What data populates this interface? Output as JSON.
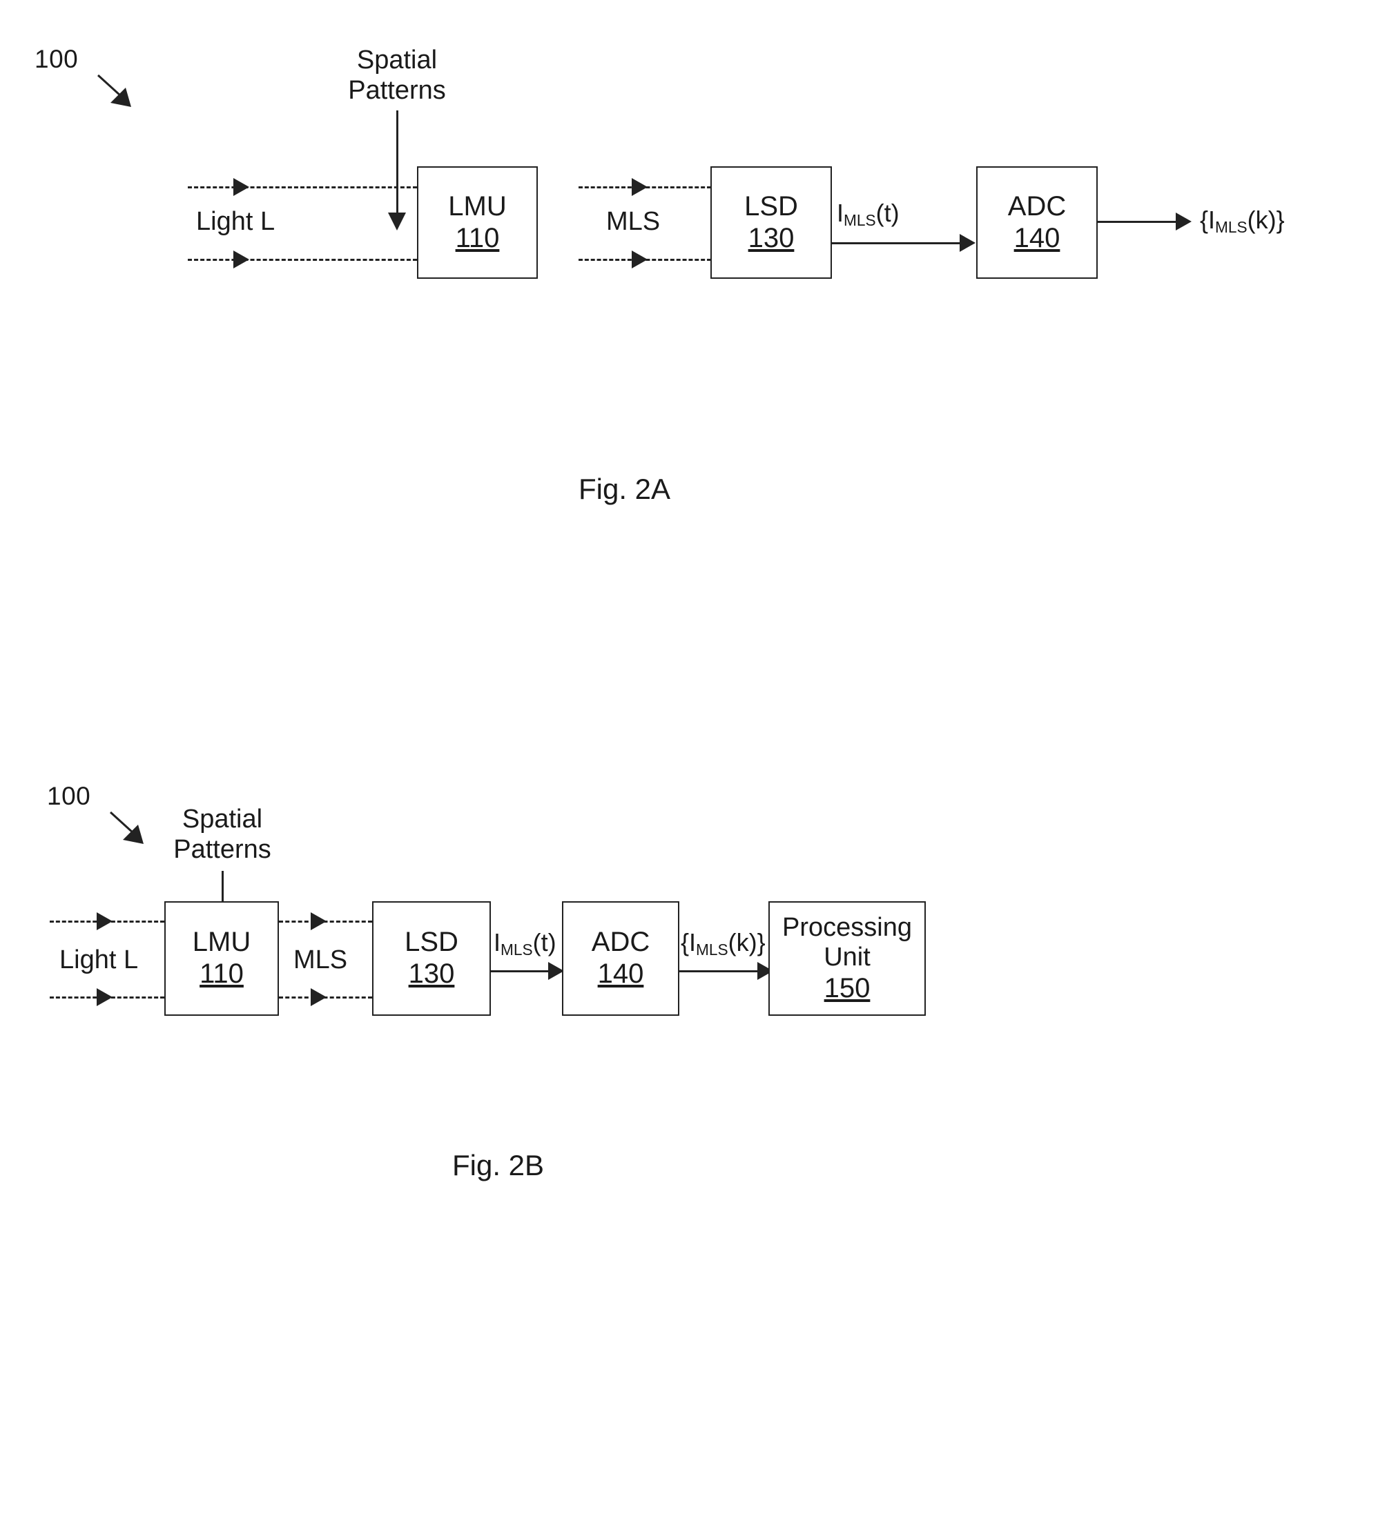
{
  "figures": [
    {
      "id": "2a",
      "caption": "Fig. 2A",
      "system_numeral": "100",
      "control_input": {
        "line1": "Spatial",
        "line2": "Patterns"
      },
      "input_label": "Light L",
      "interstage_label": "MLS",
      "analog_signal_label": {
        "base": "I",
        "sub": "MLS",
        "tail": "(t)"
      },
      "output_label": {
        "prefix": "{",
        "base": "I",
        "sub": "MLS",
        "tail": "(k)}"
      },
      "blocks": [
        {
          "name": "LMU",
          "numeral": "110"
        },
        {
          "name": "LSD",
          "numeral": "130"
        },
        {
          "name": "ADC",
          "numeral": "140"
        }
      ]
    },
    {
      "id": "2b",
      "caption": "Fig. 2B",
      "system_numeral": "100",
      "control_input": {
        "line1": "Spatial",
        "line2": "Patterns"
      },
      "input_label": "Light L",
      "interstage_label": "MLS",
      "analog_signal_label": {
        "base": "I",
        "sub": "MLS",
        "tail": "(t)"
      },
      "digital_signal_label": {
        "prefix": "{",
        "base": "I",
        "sub": "MLS",
        "tail": "(k)}"
      },
      "blocks": [
        {
          "name": "LMU",
          "numeral": "110"
        },
        {
          "name": "LSD",
          "numeral": "130"
        },
        {
          "name": "ADC",
          "numeral": "140"
        },
        {
          "name_line1": "Processing",
          "name_line2": "Unit",
          "numeral": "150"
        }
      ]
    }
  ],
  "colors": {
    "ink": "#222222",
    "background": "#ffffff"
  }
}
